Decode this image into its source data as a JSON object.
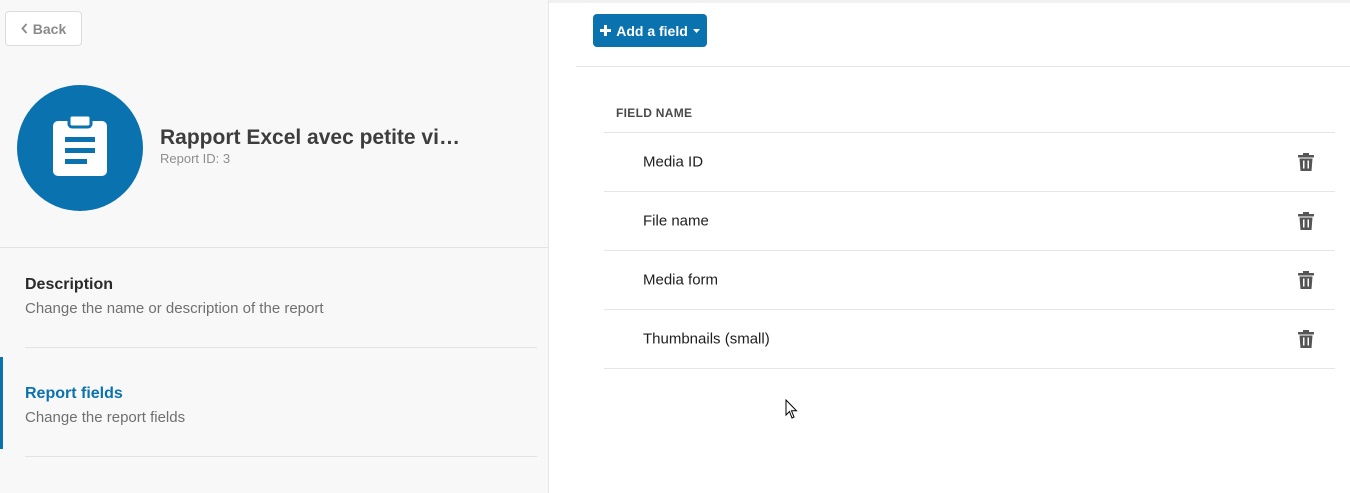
{
  "header": {
    "back_label": "Back"
  },
  "report": {
    "title": "Rapport Excel avec petite vign...",
    "id_text": "Report ID: 3",
    "icon": "clipboard-list-icon"
  },
  "sidebar": {
    "items": [
      {
        "title": "Description",
        "subtitle": "Change the name or description of the report",
        "active": false
      },
      {
        "title": "Report fields",
        "subtitle": "Change the report fields",
        "active": true
      }
    ]
  },
  "toolbar": {
    "add_field_label": "Add a field"
  },
  "table": {
    "column_header": "FIELD NAME",
    "rows": [
      {
        "name": "Media ID"
      },
      {
        "name": "File name"
      },
      {
        "name": "Media form"
      },
      {
        "name": "Thumbnails (small)"
      }
    ]
  },
  "colors": {
    "accent": "#0b72b0",
    "panel_bg": "#f8f8f8",
    "text_muted": "#707070"
  }
}
